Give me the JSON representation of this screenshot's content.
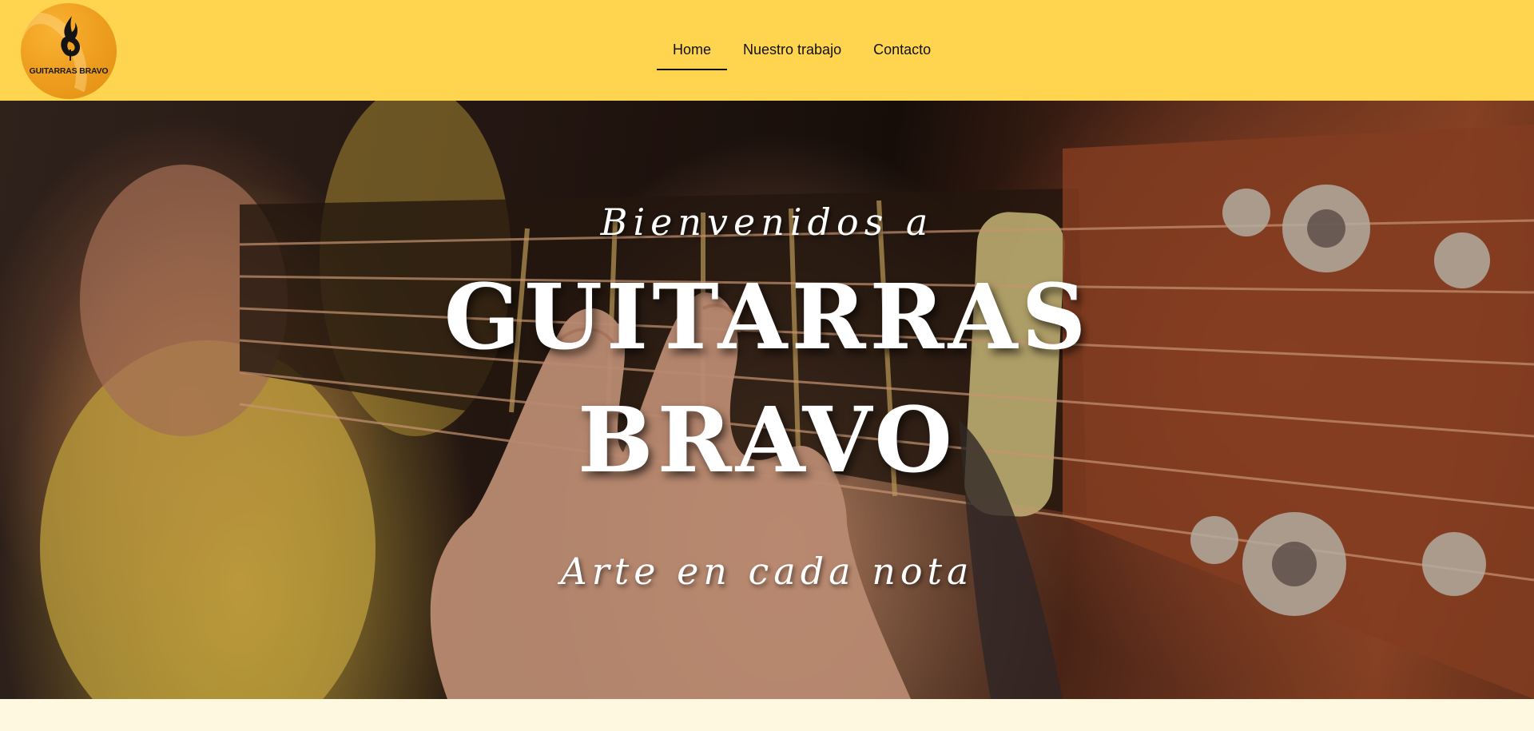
{
  "brand": {
    "logo_text": "GUITARRAS BRAVO",
    "logo_icon": "flame-guitar-icon"
  },
  "nav": {
    "items": [
      {
        "label": "Home",
        "active": true
      },
      {
        "label": "Nuestro trabajo",
        "active": false
      },
      {
        "label": "Contacto",
        "active": false
      }
    ]
  },
  "hero": {
    "welcome": "Bienvenidos a",
    "title_line1": "GUITARRAS",
    "title_line2": "BRAVO",
    "tagline": "Arte en cada nota",
    "image": "guitar-playing-photo"
  },
  "colors": {
    "header_bg": "#ffd54f",
    "page_bg": "#fff8e1",
    "hero_text": "#ffffff",
    "logo_orange": "#f0a020"
  }
}
